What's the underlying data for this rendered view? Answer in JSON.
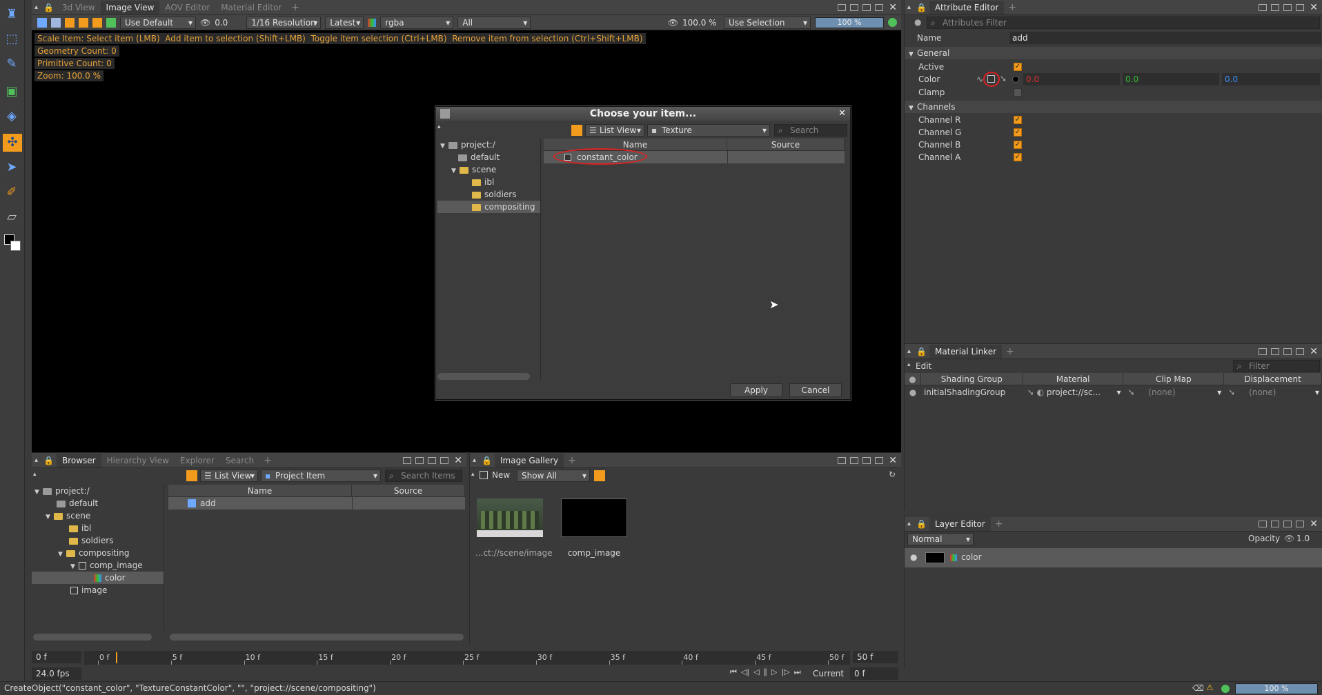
{
  "left_toolbar": {
    "icons": [
      "render-tool-icon",
      "bucket-tool-icon",
      "picker-tool-icon",
      "gallery-tool-icon",
      "camera-tool-icon",
      "scale-tool-icon",
      "select-tool-icon",
      "paint-tool-icon",
      "eraser-tool-icon",
      "color-swatch-icon"
    ]
  },
  "viewer": {
    "tabs": [
      "3d View",
      "Image View",
      "AOV Editor",
      "Material Editor"
    ],
    "active_tab": "Image View",
    "toolbar": {
      "view_mode": "Use Default",
      "exposure": "0.0",
      "resolution": "1/16 Resolution",
      "version": "Latest",
      "channel": "rgba",
      "layer": "All",
      "zoom": "100.0 %",
      "selection_mode": "Use Selection",
      "progress_label": "100 %",
      "progress_fraction": 1.0
    },
    "hud": {
      "hint": "Scale Item: Select item (LMB)  Add item to selection (Shift+LMB)  Toggle item selection (Ctrl+LMB)  Remove item from selection (Ctrl+Shift+LMB)",
      "geometry_count": "Geometry Count: 0",
      "primitive_count": "Primitive Count: 0",
      "zoom": "Zoom: 100.0 %"
    }
  },
  "dialog": {
    "title": "Choose your item...",
    "view_mode": "List View",
    "type_filter": "Texture",
    "search_placeholder": "Search Items",
    "tree": {
      "root": "project:/",
      "default": "default",
      "scene": "scene",
      "ibl": "ibl",
      "soldiers": "soldiers",
      "compositing": "compositing"
    },
    "columns": {
      "name": "Name",
      "source": "Source"
    },
    "rows": [
      {
        "name": "constant_color",
        "source": ""
      }
    ],
    "apply_label": "Apply",
    "cancel_label": "Cancel"
  },
  "attribute_editor": {
    "tab": "Attributes Editor",
    "tab_label": "Attribute Editor",
    "filter_placeholder": "Attributes Filter",
    "name_label": "Name",
    "name_value": "add",
    "general": "General",
    "active_label": "Active",
    "color_label": "Color",
    "color_r": "0.0",
    "color_g": "0.0",
    "color_b": "0.0",
    "clamp_label": "Clamp",
    "channels": "Channels",
    "channel_r": "Channel R",
    "channel_g": "Channel G",
    "channel_b": "Channel B",
    "channel_a": "Channel A"
  },
  "material_linker": {
    "tab": "Material Linker",
    "edit_label": "Edit",
    "filter_placeholder": "Filter",
    "columns": [
      "Shading Group",
      "Material",
      "Clip Map",
      "Displacement"
    ],
    "row": {
      "shading_group": "initialShadingGroup",
      "material": "project://sc...",
      "clip_map": "(none)",
      "displacement": "(none)"
    }
  },
  "layer_editor": {
    "tab": "Layer Editor",
    "blend_mode": "Normal",
    "opacity_label": "Opacity",
    "opacity_value": "1.0",
    "layer_name": "color"
  },
  "browser": {
    "tabs": [
      "Browser",
      "Hierarchy View",
      "Explorer",
      "Search"
    ],
    "view_mode": "List View",
    "type_filter": "Project Item",
    "search_placeholder": "Search Items",
    "tree": {
      "root": "project:/",
      "default": "default",
      "scene": "scene",
      "ibl": "ibl",
      "soldiers": "soldiers",
      "compositing": "compositing",
      "comp_image": "comp_image",
      "color": "color",
      "image": "image"
    },
    "columns": {
      "name": "Name",
      "source": "Source"
    },
    "rows": [
      {
        "name": "add",
        "source": ""
      }
    ]
  },
  "gallery": {
    "tab": "Image Gallery",
    "new_label": "New",
    "show_mode": "Show All",
    "items": [
      {
        "label": "...ct://scene/image"
      },
      {
        "label": "comp_image"
      }
    ]
  },
  "timeline": {
    "start": "0 f",
    "end": "50 f",
    "ticks": [
      "0 f",
      "5 f",
      "10 f",
      "15 f",
      "20 f",
      "25 f",
      "30 f",
      "35 f",
      "40 f",
      "45 f",
      "50 f"
    ],
    "fps": "24.0 fps",
    "current_label": "Current",
    "current_value": "0 f"
  },
  "status": {
    "command": "CreateObject(\"constant_color\", \"TextureConstantColor\", \"\", \"project://scene/compositing\")",
    "progress_label": "100 %",
    "progress_fraction": 1.0
  },
  "colors": {
    "accent": "#f29b1d",
    "hud_text": "#e8a33a",
    "red": "#e03030",
    "green": "#30c030",
    "blue": "#3c8cff"
  }
}
